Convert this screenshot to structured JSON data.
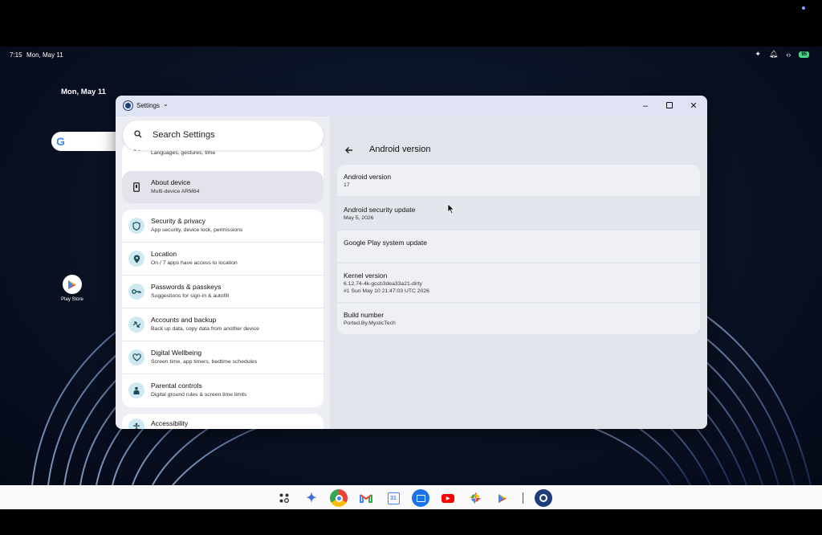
{
  "status_bar": {
    "time": "7:15",
    "date": "Mon, May 11",
    "battery": "95"
  },
  "desktop": {
    "date_widget": "Mon, May 11",
    "play_store_label": "Play Store"
  },
  "window": {
    "app_title": "Settings"
  },
  "left_pane": {
    "search_placeholder": "Search Settings",
    "partial_item_subtitle": "Languages, gestures, time",
    "about": {
      "title": "About device",
      "subtitle": "Multi-device ARM64"
    },
    "items": [
      {
        "title": "Security & privacy",
        "subtitle": "App security, device lock, permissions",
        "icon": "shield-icon"
      },
      {
        "title": "Location",
        "subtitle": "On / 7 apps have access to location",
        "icon": "location-pin-icon"
      },
      {
        "title": "Passwords & passkeys",
        "subtitle": "Suggestions for sign-in & autofill",
        "icon": "key-icon"
      },
      {
        "title": "Accounts and backup",
        "subtitle": "Back up data, copy data from another device",
        "icon": "accounts-sync-icon"
      },
      {
        "title": "Digital Wellbeing",
        "subtitle": "Screen time, app timers, bedtime schedules",
        "icon": "wellbeing-heart-icon"
      },
      {
        "title": "Parental controls",
        "subtitle": "Digital ground rules & screen time limits",
        "icon": "parental-icon"
      }
    ],
    "accessibility_title": "Accessibility"
  },
  "right_pane": {
    "title": "Android version",
    "rows": [
      {
        "title": "Android version",
        "value": "17"
      },
      {
        "title": "Android security update",
        "value": "May 5, 2026"
      },
      {
        "title": "Google Play system update",
        "value": ""
      },
      {
        "title": "Kernel version",
        "value": "6.12.74-4k-gccb3dea33a21-dirty",
        "value2": "#1 Sun May 10 21:47:03 UTC 2026"
      },
      {
        "title": "Build number",
        "value": "Ported.By.MysticTech"
      }
    ]
  },
  "taskbar": {
    "apps": [
      "launcher-icon",
      "gemini-icon",
      "chrome-icon",
      "gmail-icon",
      "calendar-icon",
      "files-icon",
      "youtube-icon",
      "photos-icon",
      "play-store-icon",
      "settings-icon"
    ],
    "calendar_day": "31"
  },
  "colors": {
    "accent": "#1f3d7a",
    "icon_bg": "#cfe9f2",
    "window_bg": "#e5e7f0"
  }
}
